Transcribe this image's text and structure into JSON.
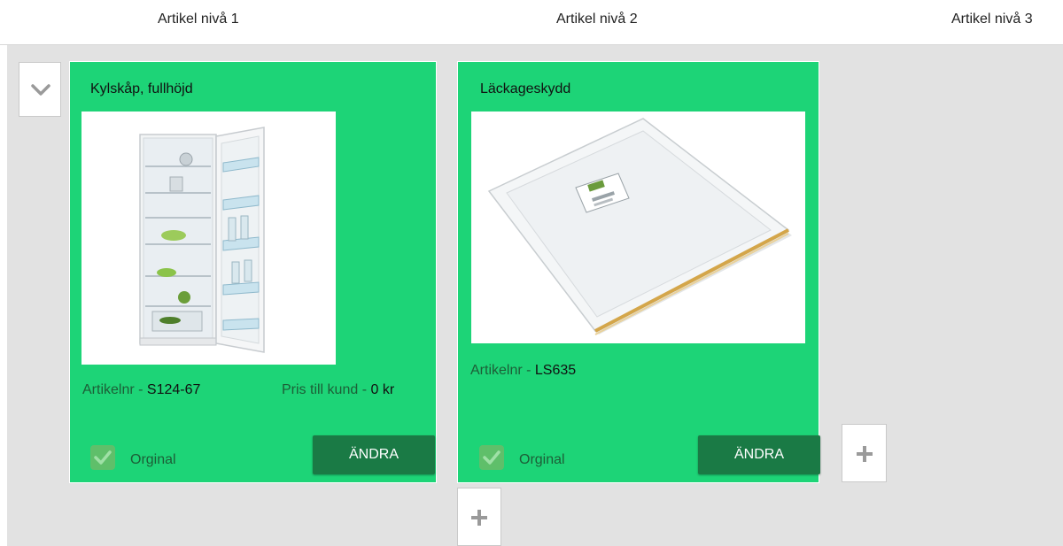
{
  "columns": {
    "level1": "Artikel nivå 1",
    "level2": "Artikel nivå 2",
    "level3": "Artikel nivå 3"
  },
  "cards": [
    {
      "title": "Kylskåp, fullhöjd",
      "image_icon": "refrigerator-photo",
      "article_label": "Artikelnr",
      "separator": " - ",
      "article_number": "S124-67",
      "price_label": "Pris till kund",
      "price_value": "0 kr",
      "original_label": "Orginal",
      "original_checked": true,
      "edit_label": "ÄNDRA"
    },
    {
      "title": "Läckageskydd",
      "image_icon": "leak-protection-tray-photo",
      "article_label": "Artikelnr",
      "separator": " - ",
      "article_number": "LS635",
      "original_label": "Orginal",
      "original_checked": true,
      "edit_label": "ÄNDRA"
    }
  ],
  "colors": {
    "card_bg": "#1dd477",
    "button_bg": "#1a7a45",
    "workspace_bg": "#e2e2e2",
    "checkbox_bg": "#5fbf6a"
  },
  "icons": {
    "collapse": "chevron-down-icon",
    "add": "plus-icon"
  }
}
